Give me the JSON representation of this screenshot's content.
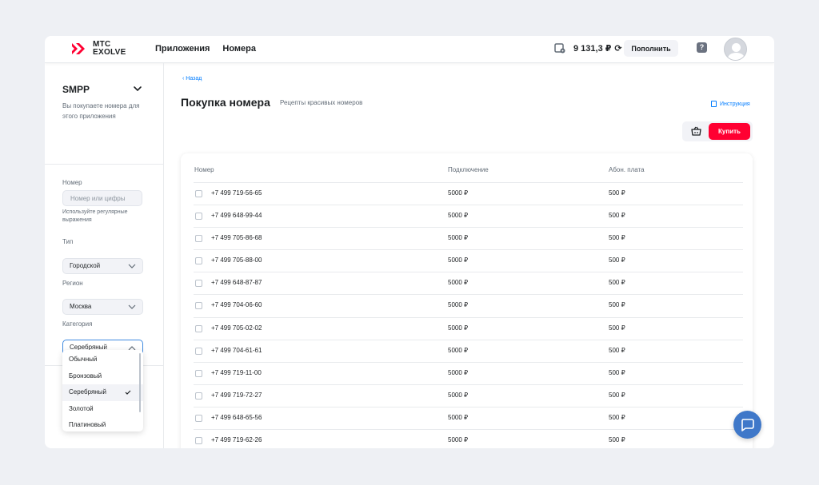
{
  "brand": {
    "line1": "МТС",
    "line2": "EXOLVE",
    "color": "#ff0032"
  },
  "nav": {
    "apps": "Приложения",
    "numbers": "Номера"
  },
  "balance": {
    "amount": "9 131,3 ₽",
    "topup_label": "Пополнить"
  },
  "header_icons": {
    "wallet": "wallet-icon",
    "refresh": "refresh-icon",
    "help": "help-icon",
    "avatar": "avatar"
  },
  "sidebar": {
    "title": "SMPP",
    "description": "Вы покупаете номера для этого приложения",
    "number_label": "Номер",
    "number_placeholder": "Номер или цифры",
    "number_hint": "Используйте регулярные выражения",
    "type_label": "Тип",
    "type_value": "Городской",
    "region_label": "Регион",
    "region_value": "Москва",
    "category_label": "Категория",
    "category_value": "Серебряный",
    "category_options": [
      "Обычный",
      "Бронзовый",
      "Серебряный",
      "Золотой",
      "Платиновый"
    ]
  },
  "main": {
    "back": "Назад",
    "title": "Покупка номера",
    "subtitle": "Рецепты красивых номеров",
    "instruction": "Инструкция",
    "buy_label": "Купить"
  },
  "table": {
    "columns": [
      "Номер",
      "Подключение",
      "Абон. плата"
    ],
    "rows": [
      [
        "+7 499 719-56-65",
        "5000 ₽",
        "500 ₽"
      ],
      [
        "+7 499 648-99-44",
        "5000 ₽",
        "500 ₽"
      ],
      [
        "+7 499 705-86-68",
        "5000 ₽",
        "500 ₽"
      ],
      [
        "+7 499 705-88-00",
        "5000 ₽",
        "500 ₽"
      ],
      [
        "+7 499 648-87-87",
        "5000 ₽",
        "500 ₽"
      ],
      [
        "+7 499 704-06-60",
        "5000 ₽",
        "500 ₽"
      ],
      [
        "+7 499 705-02-02",
        "5000 ₽",
        "500 ₽"
      ],
      [
        "+7 499 704-61-61",
        "5000 ₽",
        "500 ₽"
      ],
      [
        "+7 499 719-11-00",
        "5000 ₽",
        "500 ₽"
      ],
      [
        "+7 499 719-72-27",
        "5000 ₽",
        "500 ₽"
      ],
      [
        "+7 499 648-65-56",
        "5000 ₽",
        "500 ₽"
      ],
      [
        "+7 499 719-62-26",
        "5000 ₽",
        "500 ₽"
      ]
    ]
  },
  "accent": "#007cff"
}
